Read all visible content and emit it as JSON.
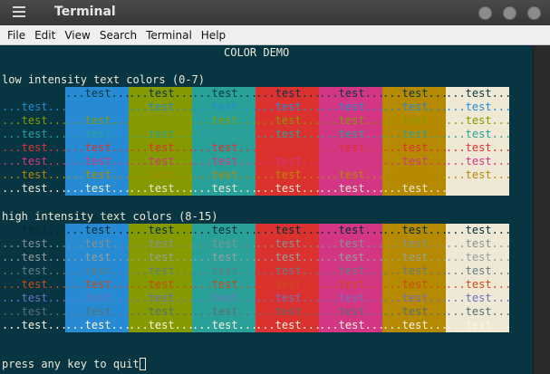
{
  "window": {
    "title": "Terminal"
  },
  "menu": [
    "File",
    "Edit",
    "View",
    "Search",
    "Terminal",
    "Help"
  ],
  "terminal": {
    "header": "COLOR DEMO",
    "low_label": "low intensity text colors (0-7)",
    "high_label": "high intensity text colors (8-15)",
    "cell_text": "...test...",
    "prompt": "press any key to quit",
    "colors": {
      "background": "#073642",
      "default_fg": "#eee8d5",
      "bg_blue": "#268bd2",
      "bg_yellowgreen": "#859900",
      "bg_cyan": "#2aa198",
      "bg_red": "#dc322f",
      "bg_magenta": "#d33682",
      "bg_yellow": "#b58900",
      "bg_cream": "#eee8d5"
    },
    "low_fg": [
      "#073642",
      "#268bd2",
      "#859900",
      "#2aa198",
      "#dc322f",
      "#d33682",
      "#b58900",
      "#eee8d5"
    ],
    "high_fg": [
      "#002b36",
      "#839496",
      "#93a1a1",
      "#657b83",
      "#cb4b16",
      "#6c71c4",
      "#586e75",
      "#fdf6e3"
    ],
    "column_bgs": [
      "#073642",
      "#268bd2",
      "#859900",
      "#2aa198",
      "#dc322f",
      "#d33682",
      "#b58900",
      "#eee8d5"
    ]
  }
}
